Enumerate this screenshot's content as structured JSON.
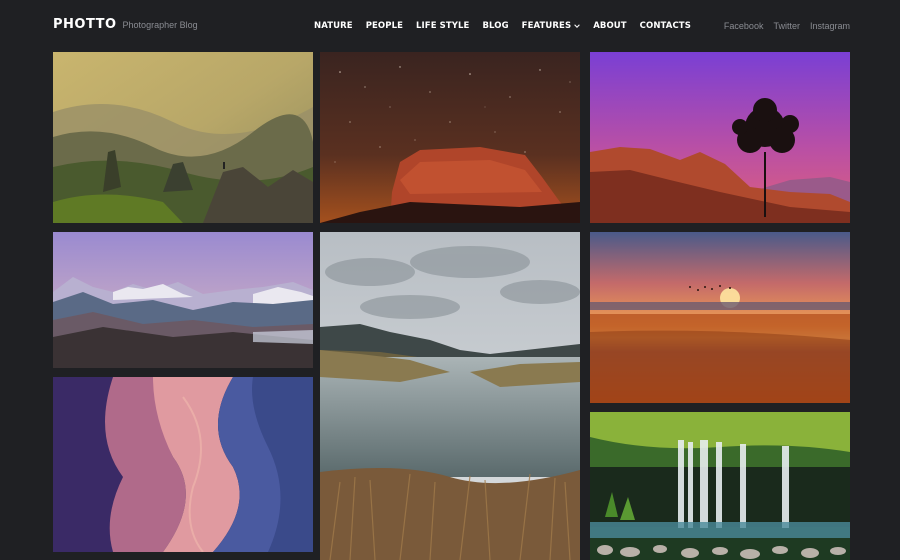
{
  "brand": {
    "logo": "PHOTTO",
    "tagline": "Photographer Blog"
  },
  "nav": {
    "items": [
      {
        "label": "NATURE"
      },
      {
        "label": "PEOPLE"
      },
      {
        "label": "LIFE STYLE"
      },
      {
        "label": "BLOG"
      },
      {
        "label": "FEATURES",
        "has_dropdown": true
      },
      {
        "label": "ABOUT"
      },
      {
        "label": "CONTACTS"
      }
    ]
  },
  "social": {
    "items": [
      "Facebook",
      "Twitter",
      "Instagram"
    ]
  },
  "gallery": {
    "tiles": [
      {
        "name": "gallery-photo-mountain-valley",
        "subject": "misty mountain valley with rock spires"
      },
      {
        "name": "gallery-photo-red-rock-night",
        "subject": "red rock under starry night sky"
      },
      {
        "name": "gallery-photo-tree-sunset",
        "subject": "lone tree on red rocks at purple sunset"
      },
      {
        "name": "gallery-photo-snowy-mountains",
        "subject": "snowy mountain range with valley fog"
      },
      {
        "name": "gallery-photo-lake-clouds",
        "subject": "cloudy lake with dry grass"
      },
      {
        "name": "gallery-photo-beach-sunset",
        "subject": "orange beach sunset with birds"
      },
      {
        "name": "gallery-photo-slot-canyon",
        "subject": "purple slot canyon walls"
      },
      {
        "name": "gallery-photo-waterfall",
        "subject": "waterfall in green jungle"
      }
    ]
  },
  "colors": {
    "background": "#1f2023",
    "text_primary": "#ffffff",
    "text_muted": "#8a8c92"
  }
}
